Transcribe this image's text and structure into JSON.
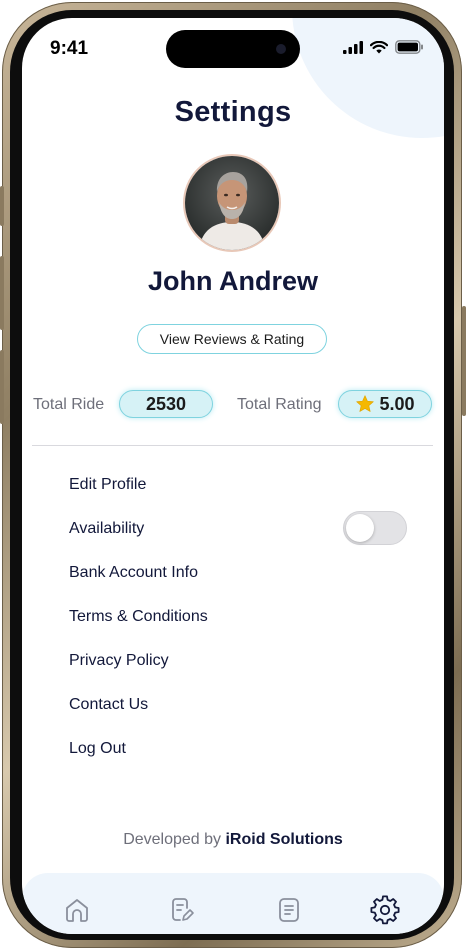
{
  "status_bar": {
    "time": "9:41",
    "icons": [
      "signal-icon",
      "wifi-icon",
      "battery-icon"
    ]
  },
  "header": {
    "title": "Settings"
  },
  "profile": {
    "name": "John Andrew",
    "reviews_button_label": "View Reviews & Rating"
  },
  "stats": {
    "total_ride_label": "Total Ride",
    "total_ride_value": "2530",
    "total_rating_label": "Total Rating",
    "total_rating_value": "5.00",
    "rating_icon": "star-icon"
  },
  "menu": {
    "items": [
      {
        "label": "Edit Profile"
      },
      {
        "label": "Availability"
      },
      {
        "label": "Bank Account Info"
      },
      {
        "label": "Terms & Conditions"
      },
      {
        "label": "Privacy Policy"
      },
      {
        "label": "Contact Us"
      },
      {
        "label": "Log Out"
      }
    ],
    "availability_toggle_on": false
  },
  "footer": {
    "developed_by_label": "Developed by",
    "company_name": "iRoid Solutions"
  },
  "tabbar": {
    "tabs": [
      {
        "icon": "home-icon"
      },
      {
        "icon": "edit-document-icon"
      },
      {
        "icon": "list-document-icon"
      },
      {
        "icon": "gear-icon",
        "active": true
      }
    ]
  },
  "colors": {
    "accent": "#7fd3df",
    "pill_fill": "#d6f2f6",
    "title_text": "#12183a",
    "muted_text": "#6e6f7a",
    "tabbar_bg": "#eef5fc",
    "star": "#f5b800"
  }
}
